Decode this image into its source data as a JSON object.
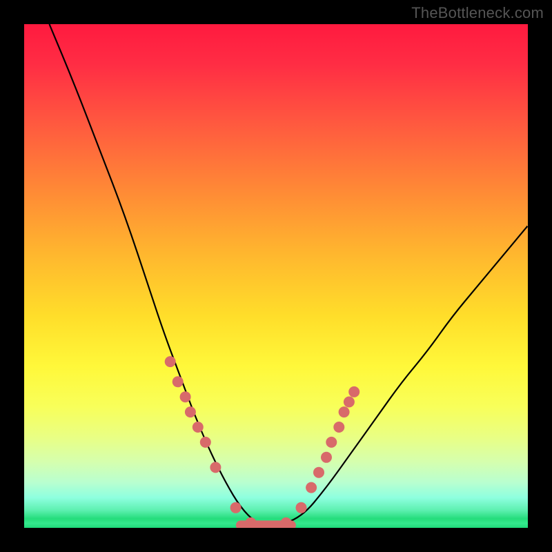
{
  "watermark": "TheBottleneck.com",
  "colors": {
    "background": "#000000",
    "marker": "#d86a6a",
    "curve": "#000000"
  },
  "chart_data": {
    "type": "line",
    "title": "",
    "xlabel": "",
    "ylabel": "",
    "xlim": [
      0,
      100
    ],
    "ylim": [
      0,
      100
    ],
    "grid": false,
    "legend": false,
    "series": [
      {
        "name": "bottleneck-curve",
        "x": [
          5,
          10,
          15,
          20,
          25,
          28,
          31,
          34,
          37,
          40,
          43,
          46,
          49,
          55,
          60,
          65,
          70,
          75,
          80,
          85,
          90,
          95,
          100
        ],
        "y": [
          100,
          88,
          75,
          62,
          47,
          38,
          30,
          22,
          15,
          9,
          4,
          1,
          0,
          2,
          8,
          15,
          22,
          29,
          35,
          42,
          48,
          54,
          60
        ]
      }
    ],
    "markers": {
      "name": "highlight-points",
      "x": [
        29,
        30.5,
        32,
        33,
        34.5,
        36,
        38,
        42,
        45,
        48,
        52,
        55,
        57,
        58.5,
        60,
        61,
        62.5,
        63.5,
        64.5,
        65.5
      ],
      "y": [
        33,
        29,
        26,
        23,
        20,
        17,
        12,
        4,
        1,
        0,
        1,
        4,
        8,
        11,
        14,
        17,
        20,
        23,
        25,
        27
      ]
    },
    "flat_segment": {
      "x0": 43,
      "x1": 53,
      "y": 0.5
    }
  }
}
